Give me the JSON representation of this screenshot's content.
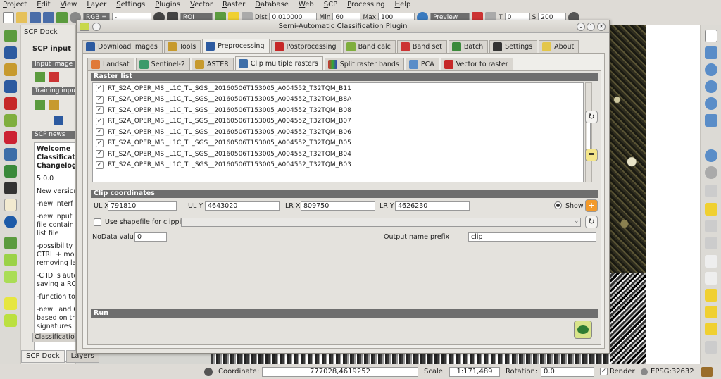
{
  "menubar": [
    "Project",
    "Edit",
    "View",
    "Layer",
    "Settings",
    "Plugins",
    "Vector",
    "Raster",
    "Database",
    "Web",
    "SCP",
    "Processing",
    "Help"
  ],
  "toolbar": {
    "rgb_label": "RGB =",
    "rgb_value": "-",
    "roi_label": "ROI",
    "dist_label": "Dist",
    "dist_value": "0.010000",
    "min_label": "Min",
    "min_value": "60",
    "max_label": "Max",
    "max_value": "100",
    "preview_label": "Preview",
    "t_label": "T",
    "t_value": "0",
    "s_label": "S",
    "s_value": "200"
  },
  "scp_dock": {
    "title": "SCP Dock",
    "scp_input": "SCP input",
    "input_image": "Input image",
    "training_input": "Training input",
    "scp_news": "SCP news",
    "news": [
      "Welcome",
      "Classificat",
      "Changelog",
      "5.0.0",
      "New version",
      "-new interf",
      "-new input",
      "file contain",
      "list file",
      "-possibility",
      "CTRL + mou",
      "removing la",
      "-C ID is auto",
      "saving a RO",
      "-function to",
      "-new Land C",
      "based on th",
      "signatures"
    ],
    "classification_tab": "Classification"
  },
  "dock_tabs": [
    "SCP Dock",
    "Layers"
  ],
  "dialog": {
    "title": "Semi-Automatic Classification Plugin",
    "main_tabs": [
      "Download images",
      "Tools",
      "Preprocessing",
      "Postprocessing",
      "Band calc",
      "Band set",
      "Batch",
      "Settings",
      "About"
    ],
    "sub_tabs": [
      "Landsat",
      "Sentinel-2",
      "ASTER",
      "Clip multiple rasters",
      "Split raster bands",
      "PCA",
      "Vector to raster"
    ],
    "raster_list_title": "Raster list",
    "rasters": [
      "RT_S2A_OPER_MSI_L1C_TL_SGS__20160506T153005_A004552_T32TQM_B11",
      "RT_S2A_OPER_MSI_L1C_TL_SGS__20160506T153005_A004552_T32TQM_B8A",
      "RT_S2A_OPER_MSI_L1C_TL_SGS__20160506T153005_A004552_T32TQM_B08",
      "RT_S2A_OPER_MSI_L1C_TL_SGS__20160506T153005_A004552_T32TQM_B07",
      "RT_S2A_OPER_MSI_L1C_TL_SGS__20160506T153005_A004552_T32TQM_B06",
      "RT_S2A_OPER_MSI_L1C_TL_SGS__20160506T153005_A004552_T32TQM_B05",
      "RT_S2A_OPER_MSI_L1C_TL_SGS__20160506T153005_A004552_T32TQM_B04",
      "RT_S2A_OPER_MSI_L1C_TL_SGS__20160506T153005_A004552_T32TQM_B03"
    ],
    "clip_title": "Clip coordinates",
    "ulx_label": "UL X",
    "ulx_value": "791810",
    "uly_label": "UL Y",
    "uly_value": "4643020",
    "lrx_label": "LR X",
    "lrx_value": "809750",
    "lry_label": "LR Y",
    "lry_value": "4626230",
    "show_label": "Show",
    "use_shapefile_label": "Use shapefile for clipping",
    "nodata_label": "NoData value",
    "nodata_value": "0",
    "prefix_label": "Output name prefix",
    "prefix_value": "clip",
    "run_title": "Run"
  },
  "statusbar": {
    "coordinate_label": "Coordinate:",
    "coordinate_value": "777028,4619252",
    "scale_label": "Scale",
    "scale_value": "1:171,489",
    "rotation_label": "Rotation:",
    "rotation_value": "0.0",
    "render_label": "Render",
    "epsg": "EPSG:32632"
  },
  "colors": {
    "section_header": "#6e6e6e",
    "panel": "#efeeea",
    "run_button": "#d9e48a"
  }
}
